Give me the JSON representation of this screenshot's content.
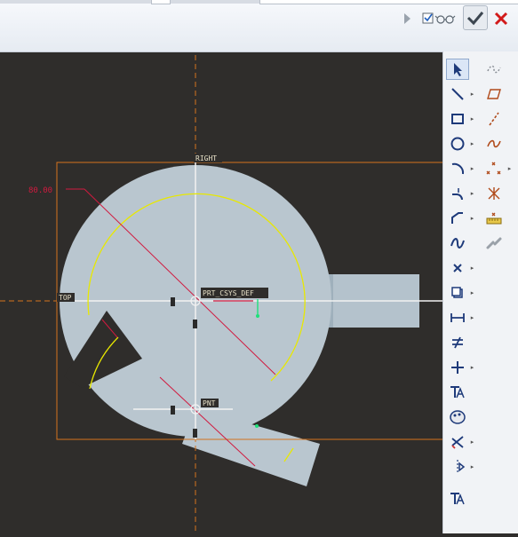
{
  "top_toolbar": {
    "expand_icon": "triangle-right-icon",
    "display_toggle_icon": "checkbox-glasses-icon",
    "accept_icon": "checkmark-icon",
    "cancel_icon": "x-icon"
  },
  "sketch": {
    "dimension_value": "80.00",
    "labels": {
      "right": "RIGHT",
      "top": "TOP",
      "csys": "PRT_CSYS_DEF",
      "csys2": "PNT"
    }
  },
  "colors": {
    "background": "#2f2d2b",
    "part_fill": "#b9c6cf",
    "reference_line": "#d4731c",
    "dimension": "#d11a3f",
    "sketch_arc": "#e8e800"
  },
  "toolbar": {
    "tools": [
      {
        "name": "select",
        "icon": "pointer-icon"
      },
      {
        "name": "line",
        "icon": "line-icon"
      },
      {
        "name": "rectangle",
        "icon": "rectangle-icon"
      },
      {
        "name": "circle",
        "icon": "circle-icon"
      },
      {
        "name": "arc",
        "icon": "arc-icon"
      },
      {
        "name": "fillet",
        "icon": "fillet-icon"
      },
      {
        "name": "chamfer",
        "icon": "chamfer-icon"
      },
      {
        "name": "spline",
        "icon": "spline-icon"
      },
      {
        "name": "point",
        "icon": "point-icon"
      },
      {
        "name": "offset",
        "icon": "offset-icon"
      },
      {
        "name": "dimension",
        "icon": "dimension-icon"
      },
      {
        "name": "modify",
        "icon": "modify-icon"
      },
      {
        "name": "constraint",
        "icon": "constraint-icon"
      },
      {
        "name": "text",
        "icon": "text-icon"
      },
      {
        "name": "palette",
        "icon": "palette-icon"
      },
      {
        "name": "trim",
        "icon": "trim-icon"
      },
      {
        "name": "mirror",
        "icon": "mirror-icon"
      },
      {
        "name": "text-2",
        "icon": "text-icon"
      }
    ],
    "secondary_tools": [
      {
        "name": "construction-spline",
        "icon": "dashed-spline-icon"
      },
      {
        "name": "plane",
        "icon": "parallelogram-icon"
      },
      {
        "name": "centerline",
        "icon": "centerline-icon"
      },
      {
        "name": "curve",
        "icon": "curve-icon"
      },
      {
        "name": "construction-points",
        "icon": "construction-points-icon"
      },
      {
        "name": "construction-point-star",
        "icon": "construction-point-icon"
      },
      {
        "name": "ruler",
        "icon": "ruler-icon"
      },
      {
        "name": "chain",
        "icon": "chain-icon"
      }
    ]
  }
}
